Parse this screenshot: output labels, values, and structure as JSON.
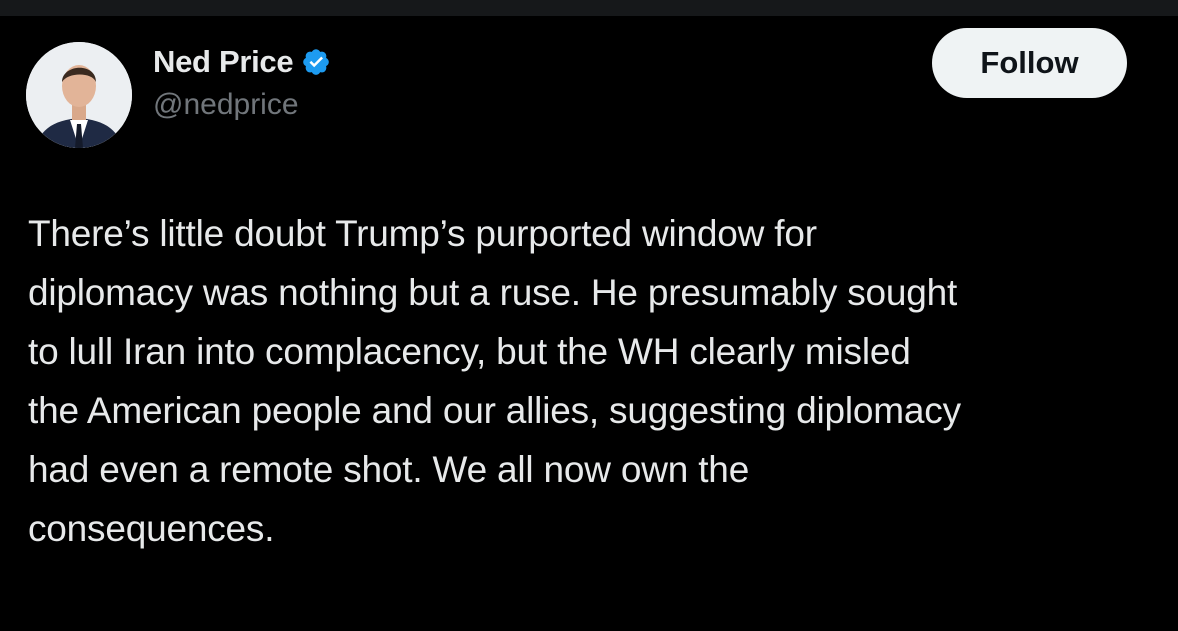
{
  "author": {
    "display_name": "Ned Price",
    "handle": "@nedprice",
    "verified": true,
    "verified_icon": "verified-badge-icon",
    "verified_color": "#1d9bf0"
  },
  "actions": {
    "follow_label": "Follow"
  },
  "tweet": {
    "text": "There’s little doubt Trump’s purported window for\ndiplomacy was nothing but a ruse. He presumably sought\nto lull Iran into complacency, but the WH clearly misled\nthe American people and our allies, suggesting diplomacy\nhad even a remote shot. We all now own the\nconsequences."
  },
  "colors": {
    "background": "#000000",
    "text_primary": "#e7e9ea",
    "text_secondary": "#71767b",
    "button_bg": "#eff3f4",
    "button_text": "#0f1419"
  }
}
